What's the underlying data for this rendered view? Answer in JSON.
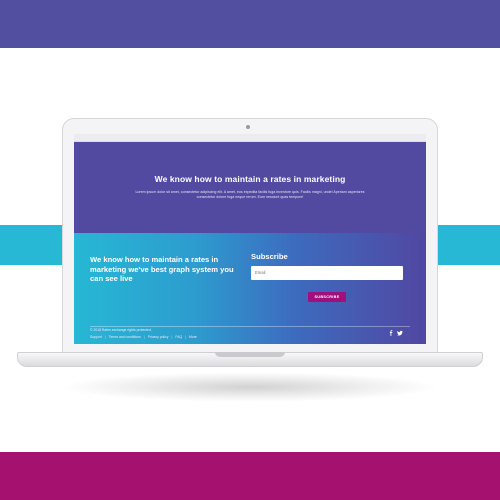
{
  "colors": {
    "band_top": "#524ea0",
    "band_middle": "#27b8d6",
    "band_bottom": "#a4116e",
    "hero_bg": "#514aa0",
    "subscribe_button": "#a1107a"
  },
  "hero": {
    "title": "We know how to maintain a rates in marketing",
    "text": "Lorem ipsum dolor sit amet, consectetur adipiscing elit. A amet, eos expedita facilis fuga inventore quis. Facilis magni, unde! Aperiam asperiores consectetur dolore fuga neque rerum. Eum nesciunt quas tempore!"
  },
  "footer": {
    "tagline": "We know how to maintain a rates in marketing we've best graph system you can see live",
    "subscribe_title": "Subscribe",
    "email_placeholder": "Email",
    "subscribe_button": "SUBSCRIBE",
    "copyright": "© 2018 Rates exchange rights protected.",
    "links": [
      "Support",
      "Terms and conditions",
      "Privacy policy",
      "FAQ",
      "More"
    ],
    "socials": [
      "facebook-icon",
      "twitter-icon"
    ]
  }
}
